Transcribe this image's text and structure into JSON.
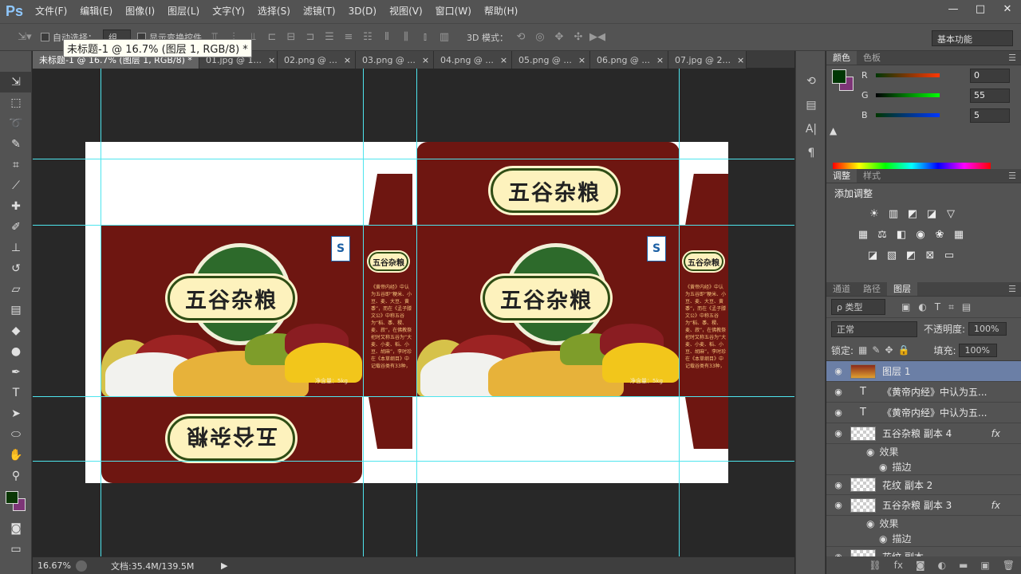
{
  "app": {
    "logo": "Ps"
  },
  "menu": [
    "文件(F)",
    "编辑(E)",
    "图像(I)",
    "图层(L)",
    "文字(Y)",
    "选择(S)",
    "滤镜(T)",
    "3D(D)",
    "视图(V)",
    "窗口(W)",
    "帮助(H)"
  ],
  "window_controls": {
    "minimize": "—",
    "maximize": "□",
    "close": "✕"
  },
  "options": {
    "auto_select": "自动选择：",
    "auto_select_value": "组",
    "show_transform": "显示变换控件",
    "mode_3d": "3D 模式：",
    "workspace": "基本功能"
  },
  "tooltip": "未标题-1 @ 16.7% (图层 1, RGB/8) *",
  "tabs": [
    {
      "label": "未标题-1 @ 16.7% (图层 1, RGB/8) *"
    },
    {
      "label": "01.jpg @ 1..."
    },
    {
      "label": "02.png @ ..."
    },
    {
      "label": "03.png @ ..."
    },
    {
      "label": "04.png @ ..."
    },
    {
      "label": "05.png @ ..."
    },
    {
      "label": "06.png @ ..."
    },
    {
      "label": "07.jpg @ 2..."
    }
  ],
  "artwork": {
    "brand": "五谷杂粮",
    "net_weight": "净含量：5kg",
    "qs_mark": "S",
    "description": "《黄帝内经》中认为五谷即“粳米、小豆、麦、大豆、黄黍”，而在《孟子滕文公》中称五谷为“稻、黍、稷、麦、菽”，在佛教祭祀时又称五谷为“大麦、小麦、稻、小豆、胡麻”，李时珍在《本草纲目》中记载谷类有33种，豆类有14种，总共47种之多。"
  },
  "color_panel": {
    "tabs": [
      "颜色",
      "色板"
    ],
    "r": "0",
    "g": "55",
    "b": "5",
    "r_label": "R",
    "g_label": "G",
    "b_label": "B",
    "fg_color": "#003705",
    "bg_color": "#7d3577"
  },
  "adjust_panel": {
    "tabs": [
      "调整",
      "样式"
    ],
    "title": "添加调整"
  },
  "layers_panel": {
    "tabs": [
      "通道",
      "路径",
      "图层"
    ],
    "kind": "ρ 类型",
    "blend": "正常",
    "opacity_label": "不透明度:",
    "opacity": "100%",
    "lock_label": "锁定:",
    "fill_label": "填充:",
    "fill": "100%",
    "layers": [
      {
        "name": "图层 1",
        "type": "image",
        "selected": true
      },
      {
        "name": "《黄帝内经》中认为五...",
        "type": "text"
      },
      {
        "name": "《黄帝内经》中认为五...",
        "type": "text"
      },
      {
        "name": "五谷杂粮 副本 4",
        "type": "pixel",
        "fx": "fx",
        "effects": [
          "效果",
          "描边"
        ]
      },
      {
        "name": "花纹 副本 2",
        "type": "pixel"
      },
      {
        "name": "五谷杂粮 副本 3",
        "type": "pixel",
        "fx": "fx",
        "effects": [
          "效果",
          "描边"
        ]
      },
      {
        "name": "花纹 副本",
        "type": "pixel"
      }
    ]
  },
  "status": {
    "zoom": "16.67%",
    "doc": "文档:35.4M/139.5M"
  }
}
